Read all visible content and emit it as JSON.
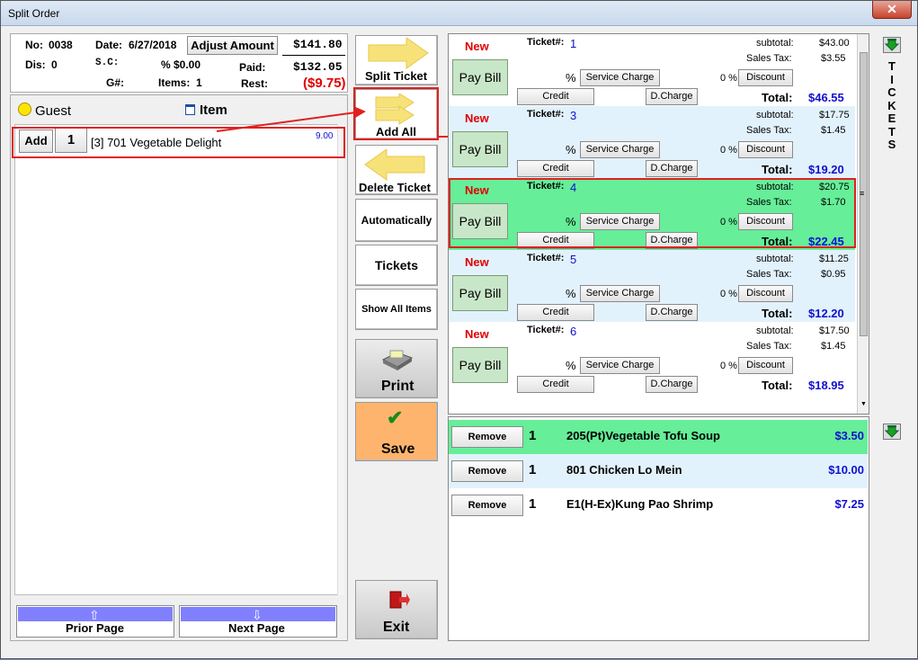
{
  "window": {
    "title": "Split Order",
    "close": "✕"
  },
  "header": {
    "no_label": "No:",
    "no_value": "0038",
    "date_label": "Date:",
    "date_value": "6/27/2018",
    "adjust_label": "Adjust Amount",
    "total": "$141.80",
    "dis_label": "Dis:",
    "dis_value": "0",
    "sc_label": "S.C:",
    "sc_pct": "%",
    "sc_value": "$0.00",
    "paid_label": "Paid:",
    "paid_value": "$132.05",
    "g_label": "G#:",
    "items_label": "Items:",
    "items_value": "1",
    "rest_label": "Rest:",
    "rest_value": "($9.75)"
  },
  "tabs": {
    "guest": "Guest",
    "item": "Item"
  },
  "left_items": [
    {
      "add": "Add",
      "qty": "1",
      "name": "[3] 701 Vegetable Delight",
      "price": "9.00"
    }
  ],
  "paging": {
    "prior": "Prior Page",
    "next": "Next Page"
  },
  "mid_buttons": {
    "split": "Split Ticket",
    "add_all": "Add All",
    "delete": "Delete Ticket",
    "auto": "Automatically",
    "tickets": "Tickets",
    "show_all": "Show All Items",
    "print": "Print",
    "save": "Save",
    "exit": "Exit"
  },
  "ticket_labels": {
    "new": "New",
    "ticket": "Ticket#:",
    "pay": "Pay Bill",
    "pct": "%",
    "service": "Service Charge",
    "disc_pct": "0 %",
    "discount": "Discount",
    "credit": "Credit",
    "dcharge": "D.Charge",
    "subtotal": "subtotal:",
    "tax": "Sales Tax:",
    "total": "Total:"
  },
  "tickets": [
    {
      "num": "1",
      "subtotal": "$43.00",
      "tax": "$3.55",
      "total": "$46.55",
      "bg": "#ffffff"
    },
    {
      "num": "3",
      "subtotal": "$17.75",
      "tax": "$1.45",
      "total": "$19.20",
      "bg": "#e2f2fc"
    },
    {
      "num": "4",
      "subtotal": "$20.75",
      "tax": "$1.70",
      "total": "$22.45",
      "bg": "#66ee99"
    },
    {
      "num": "5",
      "subtotal": "$11.25",
      "tax": "$0.95",
      "total": "$12.20",
      "bg": "#e2f2fc"
    },
    {
      "num": "6",
      "subtotal": "$17.50",
      "tax": "$1.45",
      "total": "$18.95",
      "bg": "#ffffff"
    }
  ],
  "ticket_items": [
    {
      "remove": "Remove",
      "qty": "1",
      "name": "205(Pt)Vegetable Tofu Soup",
      "price": "$3.50",
      "bg": "#66ee99"
    },
    {
      "remove": "Remove",
      "qty": "1",
      "name": "801 Chicken Lo Mein",
      "price": "$10.00",
      "bg": "#e2f2fc"
    },
    {
      "remove": "Remove",
      "qty": "1",
      "name": "E1(H-Ex)Kung Pao Shrimp",
      "price": "$7.25",
      "bg": "#ffffff"
    }
  ],
  "side": {
    "tickets_vertical": [
      "T",
      "I",
      "C",
      "K",
      "E",
      "T",
      "S"
    ]
  },
  "colors": {
    "accent_red": "#e00000",
    "accent_blue": "#1010d0",
    "selected_green": "#66ee99",
    "alt_blue": "#e2f2fc"
  }
}
